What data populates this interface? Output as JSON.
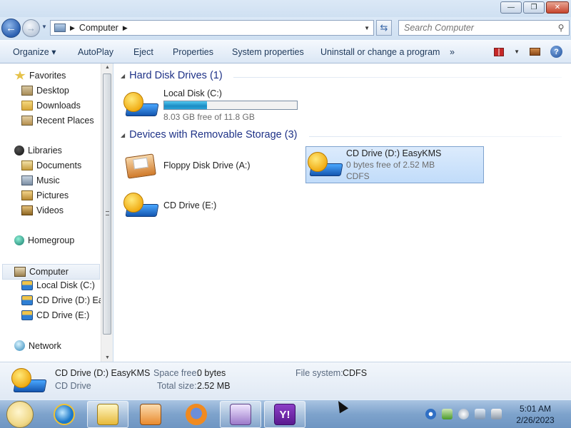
{
  "window": {
    "buttons": {
      "minimize": "—",
      "maximize": "❐",
      "close": "✕"
    }
  },
  "nav": {
    "back_icon": "arrow-left-icon",
    "forward_icon": "arrow-right-icon",
    "address_crumb": "Computer",
    "search_placeholder": "Search Computer"
  },
  "toolbar": {
    "organize": "Organize",
    "autoplay": "AutoPlay",
    "eject": "Eject",
    "properties": "Properties",
    "system_properties": "System properties",
    "uninstall": "Uninstall or change a program",
    "more": "»"
  },
  "sidebar": {
    "favorites": "Favorites",
    "desktop": "Desktop",
    "downloads": "Downloads",
    "recent_places": "Recent Places",
    "libraries": "Libraries",
    "documents": "Documents",
    "music": "Music",
    "pictures": "Pictures",
    "videos": "Videos",
    "homegroup": "Homegroup",
    "computer": "Computer",
    "local_disk": "Local Disk (C:)",
    "cd_drive_d": "CD Drive (D:) EasyKMS",
    "cd_drive_e": "CD Drive (E:)",
    "network": "Network"
  },
  "groups": {
    "hard_disk": "Hard Disk Drives (1)",
    "removable": "Devices with Removable Storage (3)"
  },
  "drives": {
    "local": {
      "name": "Local Disk (C:)",
      "free": "8.03 GB free of 11.8 GB",
      "used_fraction": 0.32
    },
    "floppy": {
      "name": "Floppy Disk Drive (A:)"
    },
    "cd_d": {
      "name": "CD Drive (D:) EasyKMS",
      "free": "0 bytes free of 2.52 MB",
      "fs": "CDFS"
    },
    "cd_e": {
      "name": "CD Drive (E:)"
    }
  },
  "details": {
    "name": "CD Drive (D:) EasyKMS",
    "type": "CD Drive",
    "space_free_label": "Space free:",
    "space_free_value": "0 bytes",
    "total_size_label": "Total size:",
    "total_size_value": "2.52 MB",
    "filesystem_label": "File system:",
    "filesystem_value": "CDFS"
  },
  "taskbar": {
    "yahoo_glyph": "Y!",
    "time": "5:01 AM",
    "date": "2/26/2023"
  }
}
